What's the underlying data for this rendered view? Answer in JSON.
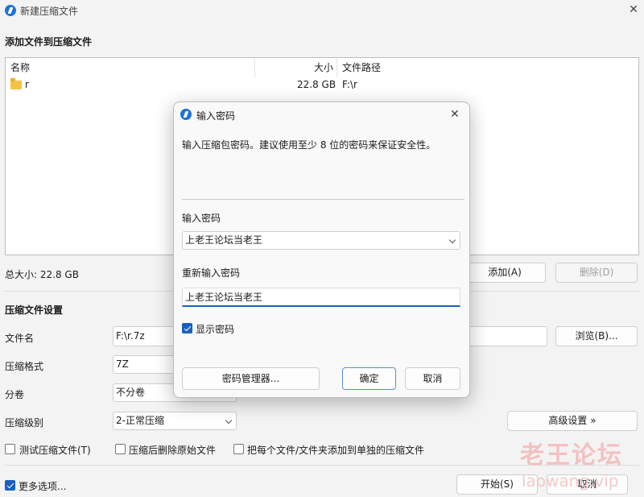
{
  "window": {
    "title": "新建压缩文件",
    "close_glyph": "✕"
  },
  "add_files": {
    "section_title": "添加文件到压缩文件",
    "columns": {
      "name": "名称",
      "size": "大小",
      "path": "文件路径"
    },
    "rows": [
      {
        "name": "r",
        "size": "22.8 GB",
        "path": "F:\\r"
      }
    ],
    "total_label": "总大小: 22.8 GB",
    "add_button": "添加(A)",
    "delete_button": "删除(D)"
  },
  "settings": {
    "section_title": "压缩文件设置",
    "filename_label": "文件名",
    "filename_value": "F:\\r.7z",
    "browse_button": "浏览(B)...",
    "format_label": "压缩格式",
    "format_value": "7Z",
    "split_label": "分卷",
    "split_value": "不分卷",
    "level_label": "压缩级别",
    "level_value": "2-正常压缩",
    "advanced_button": "高级设置 »",
    "options": [
      {
        "label": "测试压缩文件(T)",
        "checked": false
      },
      {
        "label": "压缩后删除原始文件",
        "checked": false
      },
      {
        "label": "把每个文件/文件夹添加到单独的压缩文件",
        "checked": false
      }
    ]
  },
  "footer": {
    "more_options": "更多选项...",
    "start_button": "开始(S)",
    "cancel_button": "取消"
  },
  "dialog": {
    "title": "输入密码",
    "close_glyph": "✕",
    "description": "输入压缩包密码。建议使用至少 8 位的密码来保证安全性。",
    "password_label": "输入密码",
    "password_value": "上老王论坛当老王",
    "reenter_label": "重新输入密码",
    "reenter_value": "上老王论坛当老王",
    "show_password_label": "显示密码",
    "show_password_checked": true,
    "manager_button": "密码管理器...",
    "ok_button": "确定",
    "cancel_button": "取消"
  },
  "watermark": {
    "text": "老王论坛",
    "subtext": "laowang.vip"
  },
  "colors": {
    "accent": "#1a5fbf",
    "watermark": "#f3c1c1"
  }
}
